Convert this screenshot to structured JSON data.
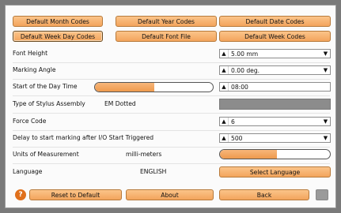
{
  "top_buttons": [
    "Default Month Codes",
    "Default Year Codes",
    "Default Date Codes",
    "Default Week Day Codes",
    "Default Font File",
    "Default Week Codes"
  ],
  "rows": {
    "font_height": {
      "label": "Font Height",
      "value": "5.00 mm"
    },
    "marking_angle": {
      "label": "Marking Angle",
      "value": "0.00 deg."
    },
    "start_of_day": {
      "label": "Start of the Day Time",
      "value": "08:00",
      "slider_fraction": 0.5
    },
    "stylus": {
      "label": "Type of Stylus Assembly",
      "value": "EM Dotted"
    },
    "force_code": {
      "label": "Force Code",
      "value": "6"
    },
    "delay": {
      "label": "Delay to start marking after I/O Start Triggered",
      "value": "500"
    },
    "units": {
      "label": "Units of Measurement",
      "value": "milli-meters",
      "slider_fraction": 0.52
    },
    "language": {
      "label": "Language",
      "value": "ENGLISH",
      "button_label": "Select Language"
    }
  },
  "bottom": {
    "help_glyph": "?",
    "reset_label": "Reset to Default",
    "about_label": "About",
    "back_label": "Back"
  },
  "icons": {
    "up": "▲",
    "down": "▼"
  },
  "colors": {
    "accent": "#f3a45c",
    "border": "#b77a3b",
    "help": "#e0701c"
  }
}
